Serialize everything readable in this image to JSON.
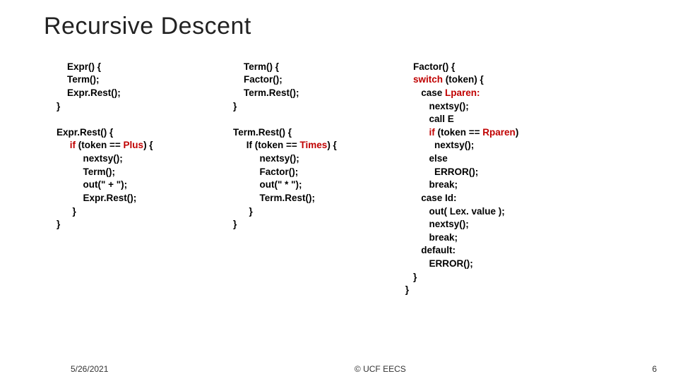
{
  "title": "Recursive Descent",
  "col1": {
    "block1": "Expr() {\n    Term();\n    Expr.Rest();\n}",
    "block2_open": "Expr.Rest() {\n     ",
    "if": "if",
    "block2_mid1": " (token == ",
    "plus": "Plus",
    "block2_mid2": ") {\n          nextsy();\n          Term();\n          out(\" + \");\n          Expr.Rest();\n      }\n}"
  },
  "col2": {
    "block1": "Term() {\n    Factor();\n    Term.Rest();\n}",
    "block2_open": "Term.Rest() {\n     If (token == ",
    "times": "Times",
    "block2_mid": ") {\n          nextsy();\n          Factor();\n          out(\" * \");\n          Term.Rest();\n      }\n}"
  },
  "col3": {
    "l1": "Factor() {\n    ",
    "switch": "switch",
    "l2": " (token) {\n       case ",
    "lparen": "Lparen:",
    "l3": "\n          nextsy();\n          call E\n          ",
    "if": "if",
    "l4": " (token == ",
    "rparen": "Rparen",
    "l5": ")\n            nextsy();\n          else\n            ERROR();\n          break;\n       case Id:\n          out( Lex. value );\n          nextsy();\n          break;\n       default:\n          ERROR();\n    }\n }"
  },
  "footer": {
    "date": "5/26/2021",
    "center": "© UCF EECS",
    "page": "6"
  }
}
